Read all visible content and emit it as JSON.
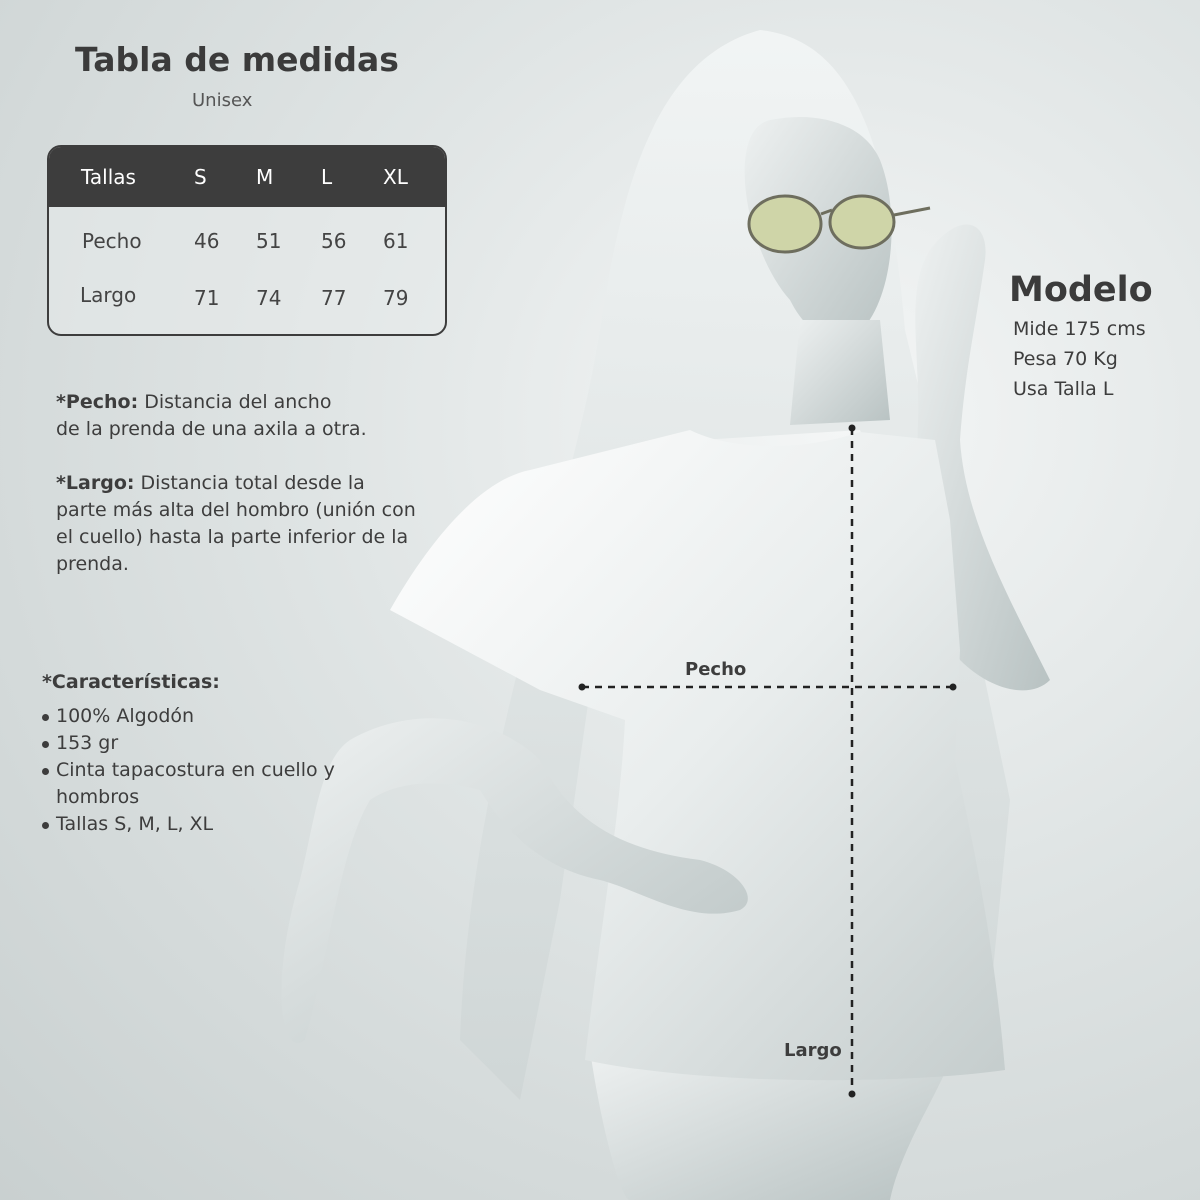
{
  "header": {
    "title": "Tabla de medidas",
    "subtitle": "Unisex"
  },
  "size_table": {
    "headers": [
      "Tallas",
      "S",
      "M",
      "L",
      "XL"
    ],
    "rows": [
      {
        "label": "Pecho",
        "values": [
          "46",
          "51",
          "56",
          "61"
        ]
      },
      {
        "label": "Largo",
        "values": [
          "71",
          "74",
          "77",
          "79"
        ]
      }
    ]
  },
  "definitions": {
    "pecho": {
      "term": "*Pecho:",
      "line1": " Distancia del ancho",
      "line2": "de la prenda de una axila a otra."
    },
    "largo": {
      "term": "*Largo:",
      "line1": " Distancia total desde la",
      "line2": "parte más alta del hombro (unión con",
      "line3": "el cuello) hasta la parte inferior de la",
      "line4": "prenda."
    }
  },
  "features": {
    "title": "*Características:",
    "items": [
      "100% Algodón",
      "153 gr",
      "Cinta tapacostura en cuello y hombros",
      "Tallas S, M, L, XL"
    ]
  },
  "model": {
    "title": "Modelo",
    "lines": [
      "Mide 175 cms",
      "Pesa 70 Kg",
      "Usa Talla L"
    ]
  },
  "measurements": {
    "chest_label": "Pecho",
    "length_label": "Largo"
  },
  "colors": {
    "table_header": "#3d3d3d",
    "text": "#3d3d3d",
    "background": "#dfe4e4"
  }
}
